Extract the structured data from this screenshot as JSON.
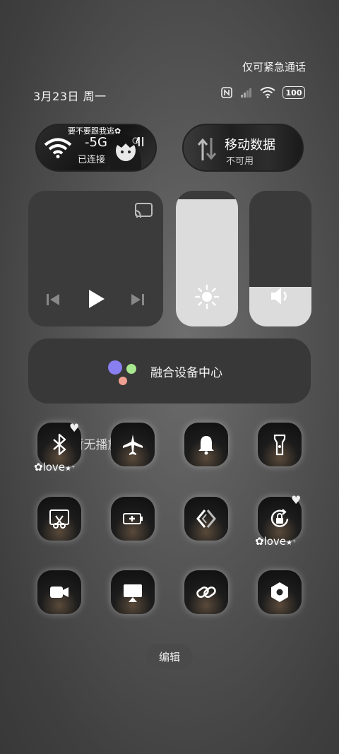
{
  "status_bar": {
    "emergency_note": "仅可紧急通话",
    "date": "3月23日 周一",
    "battery": "100"
  },
  "wifi_tile": {
    "banner": "要不要跟我逃✿",
    "network": "-5G",
    "network_suffix": "MI",
    "status": "已连接"
  },
  "data_tile": {
    "title": "移动数据",
    "status": "不可用"
  },
  "media": {
    "title": "暂无播放"
  },
  "sliders": {
    "brightness_level": 0.94,
    "volume_level": 0.29
  },
  "fusion": {
    "label": "融合设备中心",
    "dot_colors": [
      "#8a7ff0",
      "#a8e890",
      "#f0a090"
    ]
  },
  "toggles": [
    {
      "icon": "bluetooth-icon"
    },
    {
      "icon": "airplane-icon"
    },
    {
      "icon": "bell-icon"
    },
    {
      "icon": "flashlight-icon"
    },
    {
      "icon": "screenshot-icon"
    },
    {
      "icon": "battery-saver-icon"
    },
    {
      "icon": "nfc-icon"
    },
    {
      "icon": "rotation-lock-icon"
    },
    {
      "icon": "screen-record-icon"
    },
    {
      "icon": "cast-screen-icon"
    },
    {
      "icon": "link-icon"
    },
    {
      "icon": "settings-icon"
    }
  ],
  "decorations": {
    "love1": "love",
    "love2": "love"
  },
  "edit_button": "编辑"
}
